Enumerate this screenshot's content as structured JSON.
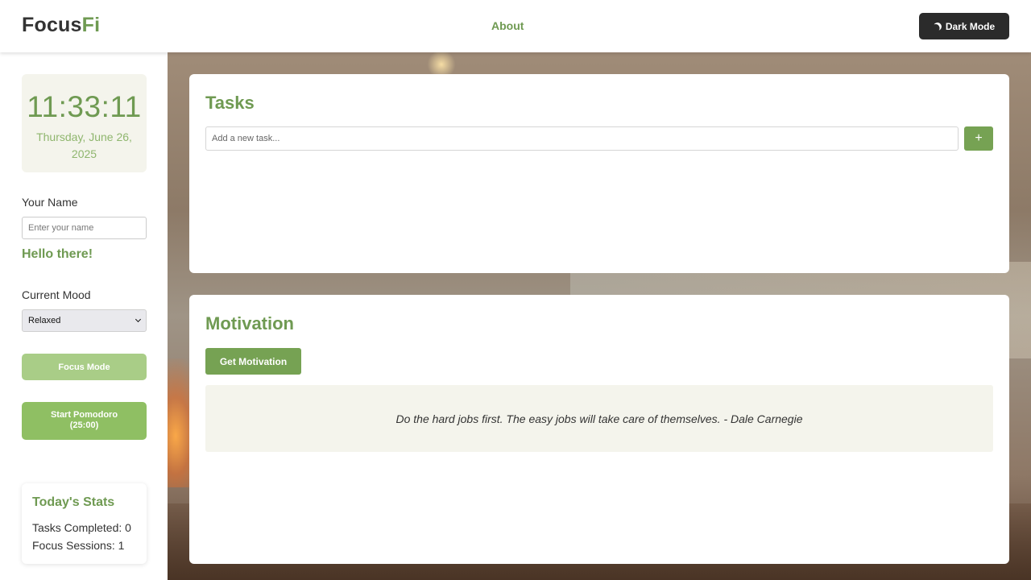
{
  "header": {
    "logo_part1": "Focus",
    "logo_part2": "Fi",
    "nav_about": "About",
    "dark_mode_label": "Dark Mode"
  },
  "sidebar": {
    "clock_time": "11:33:11",
    "clock_date": "Thursday, June 26, 2025",
    "name_label": "Your Name",
    "name_placeholder": "Enter your name",
    "greeting": "Hello there!",
    "mood_label": "Current Mood",
    "mood_selected": "Relaxed",
    "focus_mode_label": "Focus Mode",
    "pomodoro_label_line1": "Start Pomodoro",
    "pomodoro_label_line2": "(25:00)",
    "stats": {
      "title": "Today's Stats",
      "tasks_completed": "Tasks Completed: 0",
      "focus_sessions": "Focus Sessions: 1"
    }
  },
  "tasks": {
    "title": "Tasks",
    "input_placeholder": "Add a new task...",
    "add_button": "+"
  },
  "motivation": {
    "title": "Motivation",
    "button_label": "Get Motivation",
    "quote": "Do the hard jobs first. The easy jobs will take care of themselves. - Dale Carnegie"
  },
  "colors": {
    "accent": "#6f9a52",
    "button_green": "#76a253",
    "focus_button": "#a9cd87",
    "pomodoro_button": "#8fbf63",
    "dark_button": "#2b2b2b",
    "panel_beige": "#f4f4ec"
  },
  "icons": {
    "dark_mode": "moon-icon",
    "add_task": "plus-icon",
    "select": "chevron-down-icon"
  }
}
